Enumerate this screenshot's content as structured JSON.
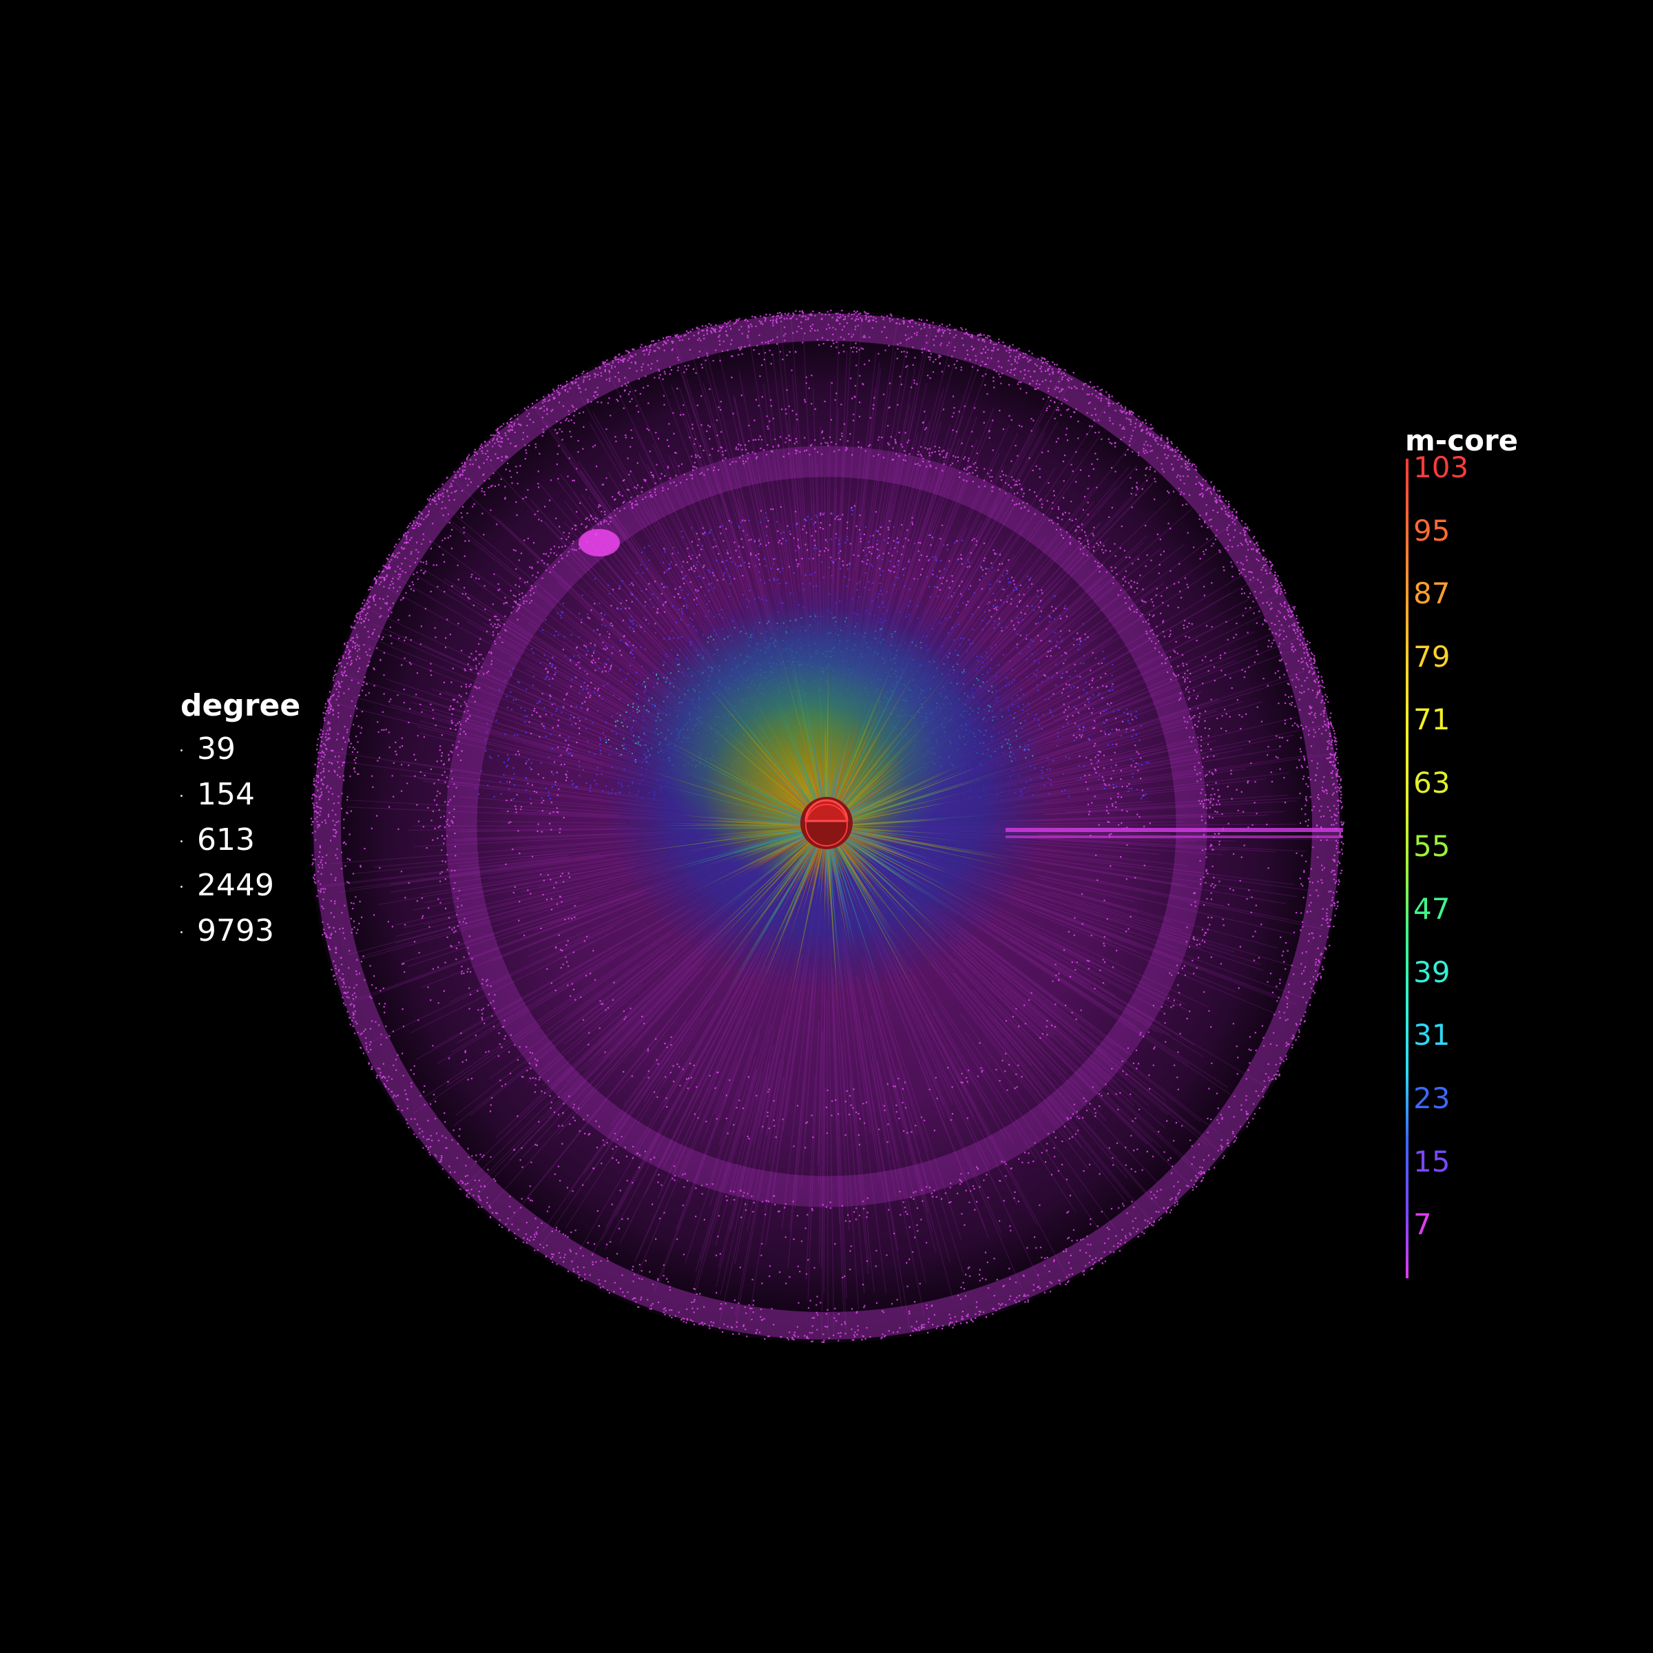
{
  "legend_degree": {
    "title": "degree",
    "items": [
      "39",
      "154",
      "613",
      "2449",
      "9793"
    ]
  },
  "legend_mcore": {
    "title": "m-core",
    "levels": [
      {
        "label": "103",
        "color": "#ff3b3b"
      },
      {
        "label": "95",
        "color": "#ff6a35"
      },
      {
        "label": "87",
        "color": "#ff9f30"
      },
      {
        "label": "79",
        "color": "#ffd22a"
      },
      {
        "label": "71",
        "color": "#f4f127"
      },
      {
        "label": "63",
        "color": "#e2f02a"
      },
      {
        "label": "55",
        "color": "#9cf23a"
      },
      {
        "label": "47",
        "color": "#3ff58a"
      },
      {
        "label": "39",
        "color": "#33f0d6"
      },
      {
        "label": "31",
        "color": "#2fd7f4"
      },
      {
        "label": "23",
        "color": "#3b68ff"
      },
      {
        "label": "15",
        "color": "#7a48ff"
      },
      {
        "label": "7",
        "color": "#e03cf0"
      }
    ]
  },
  "colors": {
    "background": "#000000",
    "shell_magenta": "#d63ce8",
    "core_red": "#e83030"
  }
}
